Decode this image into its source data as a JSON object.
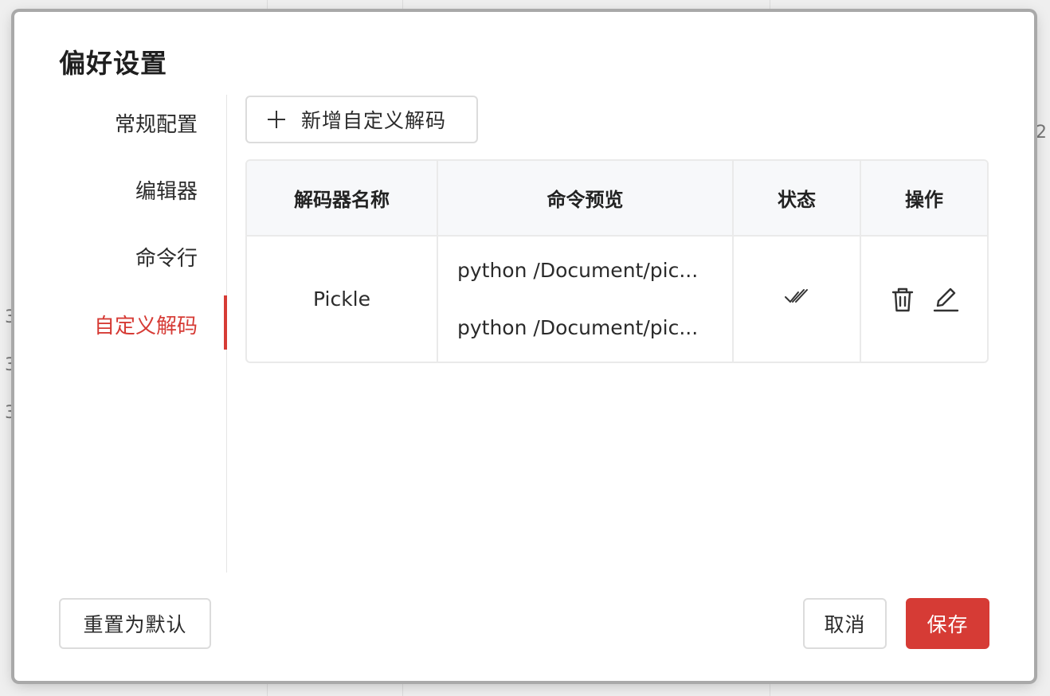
{
  "background": {
    "edge_chars": [
      "3",
      "3",
      "3",
      "2"
    ]
  },
  "dialog": {
    "title": "偏好设置"
  },
  "nav": {
    "items": [
      {
        "label": "常规配置",
        "active": false
      },
      {
        "label": "编辑器",
        "active": false
      },
      {
        "label": "命令行",
        "active": false
      },
      {
        "label": "自定义解码",
        "active": true
      }
    ]
  },
  "content": {
    "add_button_label": "新增自定义解码",
    "table": {
      "headers": [
        "解码器名称",
        "命令预览",
        "状态",
        "操作"
      ],
      "rows": [
        {
          "name": "Pickle",
          "commands": [
            "python /Document/pic...",
            "python /Document/pic..."
          ],
          "status_icon": "double-check-icon",
          "actions": [
            "trash-icon",
            "edit-icon"
          ]
        }
      ]
    }
  },
  "footer": {
    "reset_label": "重置为默认",
    "cancel_label": "取消",
    "save_label": "保存"
  },
  "colors": {
    "accent": "#d63b35",
    "border": "#eaeaea",
    "header_bg": "#f7f8fa"
  }
}
